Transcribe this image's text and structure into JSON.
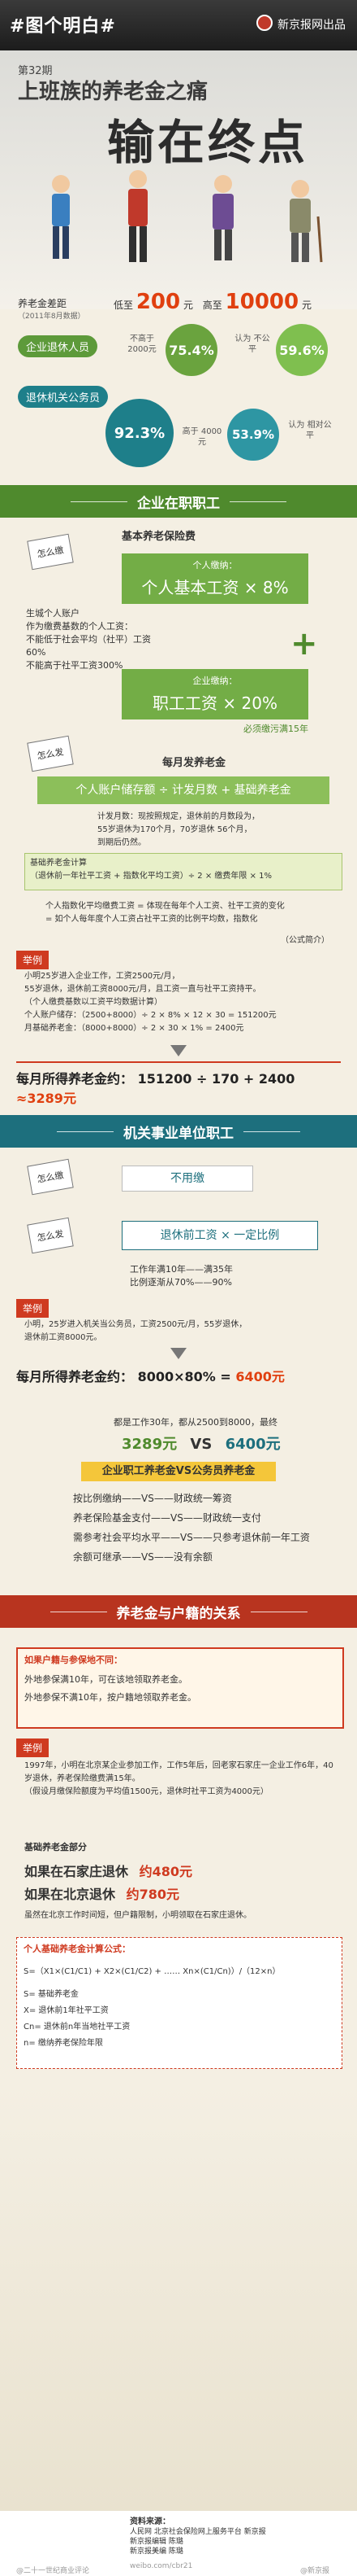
{
  "header": {
    "tag": "#图个明白#",
    "brand": "新京报网出品"
  },
  "cover": {
    "issue": "第32期",
    "title_line1": "上班族的养老金之痛",
    "title_line2": "输在终点"
  },
  "gap": {
    "label": "养老金差距",
    "sub": "（2011年8月数据）",
    "low": "低至",
    "low_val": "200",
    "low_unit": "元",
    "high": "高至",
    "high_val": "10000",
    "high_unit": "元"
  },
  "enterprise": {
    "pill": "企业退休人员",
    "c1_label": "不高于\n2000元",
    "c1_pct": "75.4%",
    "c2_label": "认为\n不公平",
    "c2_pct": "59.6%"
  },
  "civil": {
    "pill": "退休机关公务员",
    "c1_pct": "92.3%",
    "c1_label": "高于\n4000元",
    "c2_pct": "53.9%",
    "c2_label": "认为\n相对公平"
  },
  "sec1": {
    "title": "企业在职职工",
    "pay_tag": "怎么缴",
    "base_title": "基本养老保险费",
    "personal_label": "个人缴纳：",
    "personal_formula": "个人基本工资 × 8%",
    "base_note": "生城个人账户\n作为缴费基数的个人工资：\n不能低于社会平均（社平）工资60%\n不能高于社平工资300%",
    "company_label": "企业缴纳：",
    "company_formula": "职工工资 × 20%",
    "company_note": "必须缴污满15年",
    "monthly_title": "每月发养老金",
    "get_tag": "怎么发",
    "monthly_formula": "个人账户储存额 ÷ 计发月数 + 基础养老金",
    "months_note": "计发月数：现按照规定，退休前的月数段为，\n55岁退休为170个月，70岁退休 56个月，\n到期后仍然。",
    "base_formula": "基础养老金计算\n（退休前一年社平工资 + 指数化平均工资）÷ 2 × 缴费年限 × 1%",
    "index_note": "个人指数化平均缴费工资 = 体现在每年个人工资、社平工资的变化\n= 如个人每年度个人工资占社平工资的比例平均数，指数化",
    "index_src": "（公式简介）",
    "case_tag": "举例",
    "case_text": "小明25岁进入企业工作，工资2500元/月，\n55岁退休，退休前工资8000元/月，且工资一直与社平工资持平。\n（个人缴费基数以工资平均数据计算）\n个人账户储存：（2500+8000）÷ 2 × 8% × 12 × 30 = 151200元\n月基础养老金：（8000+8000）÷ 2 × 30 × 1% = 2400元",
    "result_label": "每月所得养老金约：",
    "result_formula": "151200 ÷ 170 + 2400",
    "result_value": "≈3289元"
  },
  "sec2": {
    "title": "机关事业单位职工",
    "pay_tag": "怎么缴",
    "no_pay": "不用缴",
    "get_tag": "怎么发",
    "formula": "退休前工资 × 一定比例",
    "rule": "工作年满10年——满35年\n比例逐渐从70%——90%",
    "case_tag": "举例",
    "case_text": "小明，25岁进入机关当公务员，工资2500元/月，55岁退休，\n退休前工资8000元。",
    "result_label": "每月所得养老金约：",
    "result_formula": "8000×80% =",
    "result_value": "6400元"
  },
  "compare": {
    "intro": "都是工作30年，都从2500到8000，最终",
    "left": "3289元",
    "vs": "VS",
    "right": "6400元",
    "heading": "企业职工养老金VS公务员养老金",
    "rows": [
      "按比例缴纳——VS——财政统一筹资",
      "养老保险基金支付——VS——财政统一支付",
      "需参考社会平均水平——VS——只参考退休前一年工资",
      "余额可继承——VS——没有余额"
    ]
  },
  "sec3": {
    "title": "养老金与户籍的关系",
    "q": "如果户籍与参保地不同：",
    "q1": "外地参保满10年，可在该地领取养老金。",
    "q2": "外地参保不满10年，按户籍地领取养老金。",
    "case_tag": "举例",
    "case_text": "1997年，小明在北京某企业参加工作，工作5年后，回老家石家庄一企业工作6年，40岁退休，养老保险缴费满15年。\n（假设月缴保险额度为平均值1500元，退休时社平工资为4000元）",
    "base_title": "基础养老金部分",
    "sjz": "如果在石家庄退休",
    "sjz_val": "约480元",
    "bj": "如果在北京退休",
    "bj_val": "约780元",
    "note": "虽然在北京工作时间短，但户籍限制，小明领取在石家庄退休。",
    "formula_title": "个人基础养老金计算公式：",
    "formula": "S=（X1×(C1/C1) + X2×(C1/C2) + …… Xn×(C1/Cn)）/（12×n）",
    "vars": [
      "S=  基础养老金",
      "X=  退休前1年社平工资",
      "Cn= 退休前n年当地社平工资",
      "n=  缴纳养老保险年限"
    ]
  },
  "footer": {
    "sources_title": "资料来源：",
    "sources": "人民网  北京社会保险网上服务平台  新京报\n新京报编辑 陈璐\n新京报美编 陈璐",
    "weibo": "weibo.com/cbr21",
    "credit": "@二十一世纪商业评论",
    "credit2": "@新京报"
  },
  "colors": {
    "green": "#4f8a2d",
    "teal": "#1d6f7d",
    "red": "#b8341f",
    "accent": "#e04010"
  }
}
